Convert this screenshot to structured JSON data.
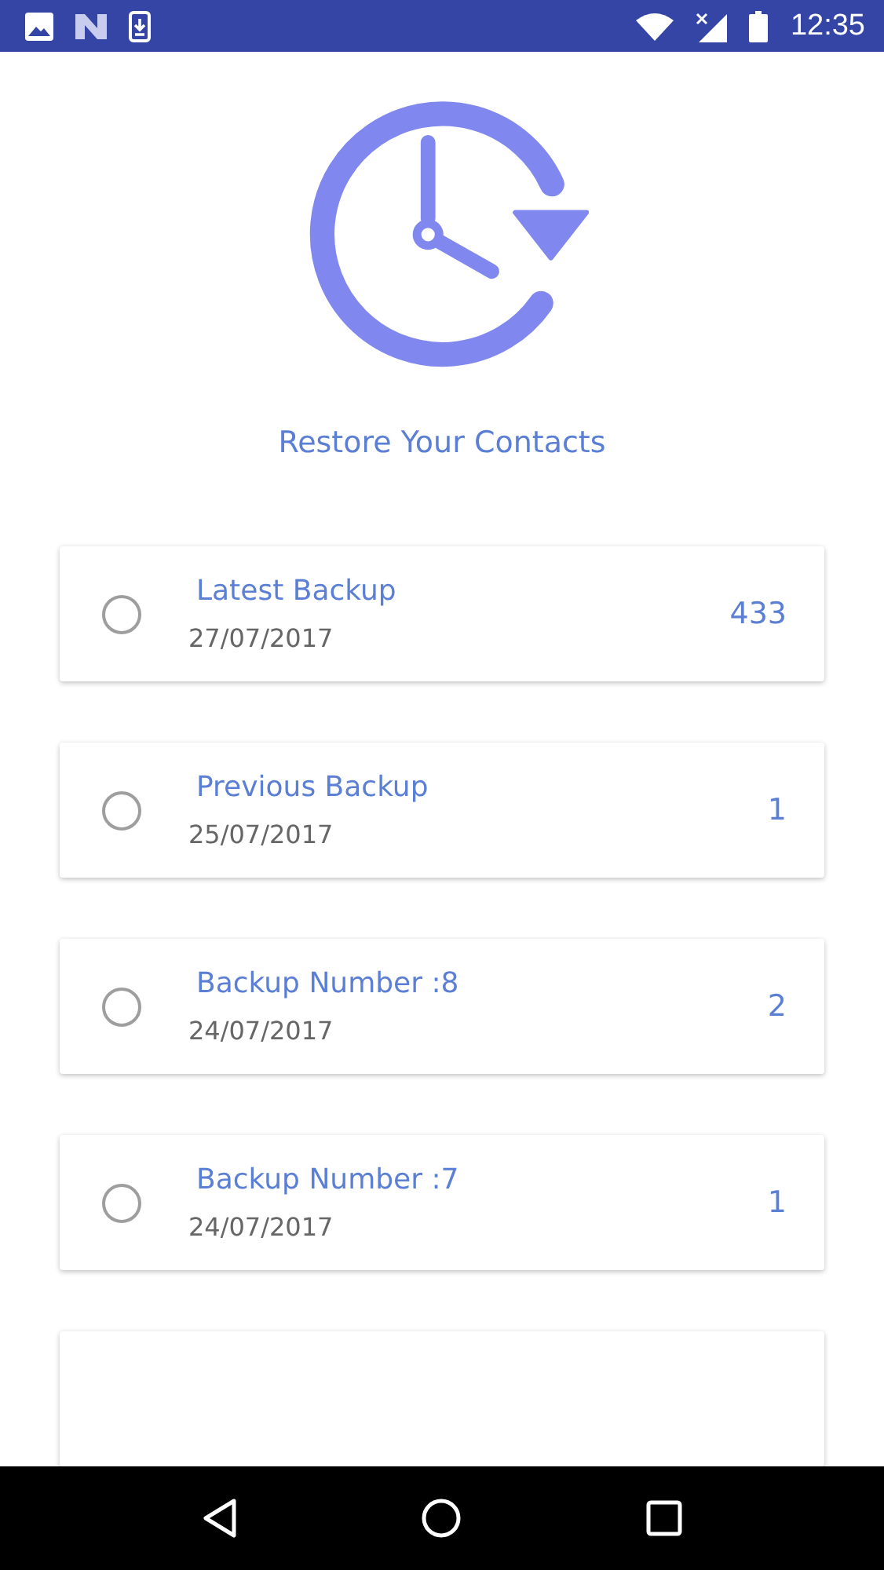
{
  "status_bar": {
    "time": "12:35"
  },
  "title": "Restore Your Contacts",
  "backups": [
    {
      "name": "Latest Backup",
      "date": "27/07/2017",
      "count": "433",
      "selected": false
    },
    {
      "name": "Previous Backup",
      "date": "25/07/2017",
      "count": "1",
      "selected": false
    },
    {
      "name": "Backup Number :8",
      "date": "24/07/2017",
      "count": "2",
      "selected": false
    },
    {
      "name": "Backup Number :7",
      "date": "24/07/2017",
      "count": "1",
      "selected": false
    }
  ]
}
